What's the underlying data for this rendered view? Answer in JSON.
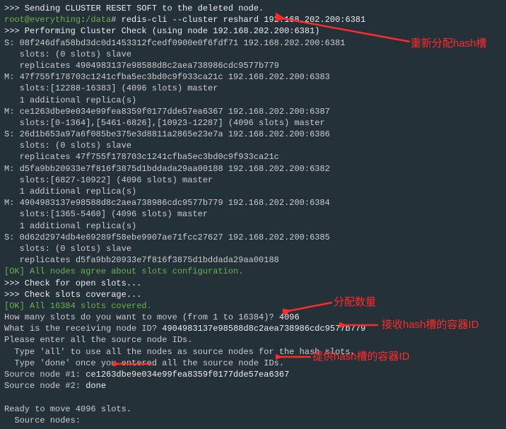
{
  "terminal": {
    "l0": ">>> Sending CLUSTER RESET SOFT to the deleted node.",
    "prompt_user": "root@everything",
    "prompt_sep1": ":",
    "prompt_path": "/data",
    "prompt_hash": "# ",
    "cmd": "redis-cli --cluster reshard 192.168.202.200:6381",
    "l2": ">>> Performing Cluster Check (using node 192.168.202.200:6381)",
    "l3": "S: 08f246dfa58bd3dc0d1453312fcedf0900e0f6fdf71 192.168.202.200:6381",
    "l4": "   slots: (0 slots) slave",
    "l5": "   replicates 4904983137e98588d8c2aea738986cdc9577b779",
    "l6": "M: 47f755f178703c1241cfba5ec3bd0c9f933ca21c 192.168.202.200:6383",
    "l7": "   slots:[12288-16383] (4096 slots) master",
    "l8": "   1 additional replica(s)",
    "l9": "M: ce1263dbe9e034e99fea8359f0177dde57ea6367 192.168.202.200:6387",
    "l10": "   slots:[0-1364],[5461-6826],[10923-12287] (4096 slots) master",
    "l11": "S: 26d1b653a97a6f085be375e3d8811a2865e23e7a 192.168.202.200:6386",
    "l12": "   slots: (0 slots) slave",
    "l13": "   replicates 47f755f178703c1241cfba5ec3bd0c9f933ca21c",
    "l14": "M: d5fa9bb20933e7f816f3875d1bddada29aa00188 192.168.202.200:6382",
    "l15": "   slots:[6827-10922] (4096 slots) master",
    "l16": "   1 additional replica(s)",
    "l17": "M: 4904983137e98588d8c2aea738986cdc9577b779 192.168.202.200:6384",
    "l18": "   slots:[1365-5460] (4096 slots) master",
    "l19": "   1 additional replica(s)",
    "l20": "S: 0d62d2974db4e69289f58ebe9907ae71fcc27627 192.168.202.200:6385",
    "l21": "   slots: (0 slots) slave",
    "l22": "   replicates d5fa9bb20933e7f816f3875d1bddada29aa00188",
    "l23": "[OK] All nodes agree about slots configuration.",
    "l24": ">>> Check for open slots...",
    "l25": ">>> Check slots coverage...",
    "l26": "[OK] All 16384 slots covered.",
    "l27a": "How many slots do you want to move (from 1 to 16384)? ",
    "l27b": "4096",
    "l28a": "What is the receiving node ID? ",
    "l28b": "4904983137e98588d8c2aea738986cdc9577b779",
    "l29": "Please enter all the source node IDs.",
    "l30": "  Type 'all' to use all the nodes as source nodes for the hash slots.",
    "l31": "  Type 'done' once you entered all the source node IDs.",
    "l32a": "Source node #1: ",
    "l32b": "ce1263dbe9e034e99fea8359f0177dde57ea6367",
    "l33a": "Source node #2: ",
    "l33b": "done",
    "l34": "",
    "l35": "Ready to move 4096 slots.",
    "l36": "  Source nodes:"
  },
  "annotations": {
    "a1": "重新分配hash槽",
    "a2": "分配数量",
    "a3": "接收hash槽的容器ID",
    "a4": "提供hash槽的容器ID"
  }
}
